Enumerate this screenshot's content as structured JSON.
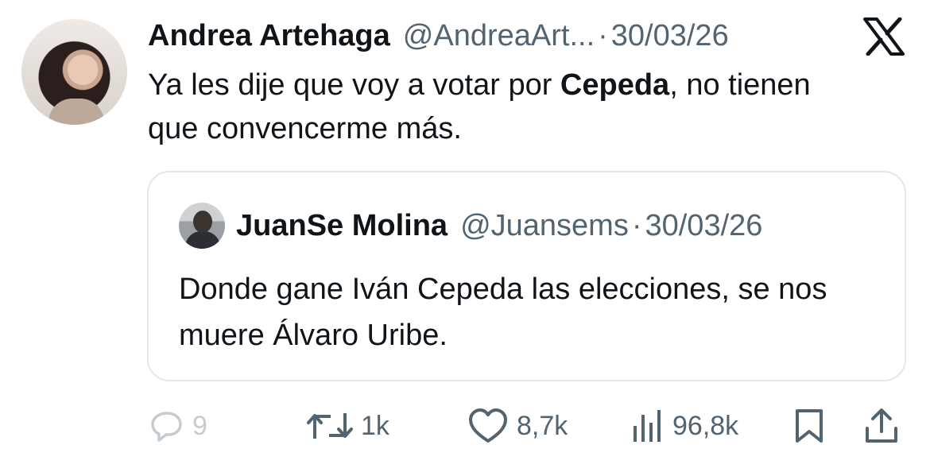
{
  "tweet": {
    "author_name": "Andrea Artehaga",
    "author_handle": "@AndreaArt...",
    "separator": "·",
    "date": "30/03/26",
    "text_before": "Ya les dije que voy a votar por ",
    "text_bold": "Cepeda",
    "text_after": ", no tienen que convencerme más."
  },
  "quoted": {
    "author_name": "JuanSe Molina",
    "author_handle": "@Juansems",
    "separator": "·",
    "date": "30/03/26",
    "text": "Donde gane Iván Cepeda las elecciones, se nos muere Álvaro Uribe."
  },
  "actions": {
    "replies": "9",
    "retweets": "1k",
    "likes": "8,7k",
    "views": "96,8k"
  },
  "icons": {
    "brand": "x-logo-icon",
    "reply": "reply-icon",
    "retweet": "retweet-icon",
    "like": "heart-icon",
    "views": "views-icon",
    "bookmark": "bookmark-icon",
    "share": "share-icon"
  },
  "colors": {
    "text": "#0f1419",
    "secondary": "#536471",
    "border": "#e1e8ed"
  }
}
